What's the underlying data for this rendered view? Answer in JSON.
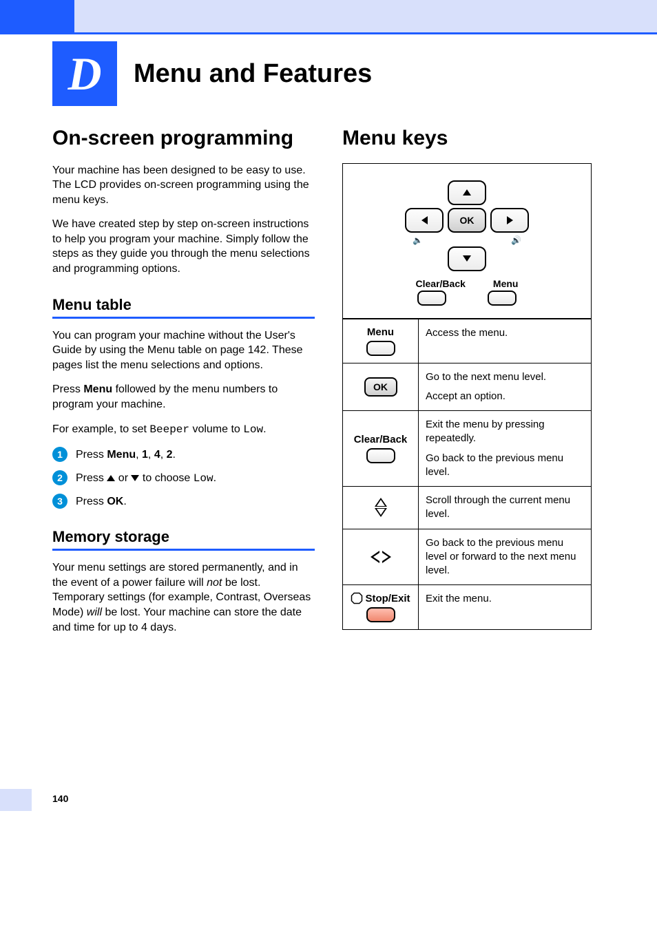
{
  "chapter": {
    "letter": "D",
    "title": "Menu and Features"
  },
  "left": {
    "h1": "On-screen programming",
    "p1": "Your machine has been designed to be easy to use. The LCD provides on-screen programming using the menu keys.",
    "p2": "We have created step by step on-screen instructions to help you program your machine. Simply follow the steps as they guide you through the menu selections and programming options.",
    "menu_table": {
      "heading": "Menu table",
      "p1": "You can program your machine without the User's Guide by using the Menu table on page 142. These pages list the menu selections and options.",
      "p2_a": "Press ",
      "p2_b": "Menu",
      "p2_c": " followed by the menu numbers to program your machine.",
      "p3_a": "For example, to set ",
      "p3_b": "Beeper",
      "p3_c": " volume to ",
      "p3_d": "Low",
      "p3_e": ".",
      "step1_a": "Press ",
      "step1_b": "Menu",
      "step1_c": ", ",
      "step1_d": "1",
      "step1_e": ", ",
      "step1_f": "4",
      "step1_g": ", ",
      "step1_h": "2",
      "step1_i": ".",
      "step2_a": "Press ",
      "step2_b": " or ",
      "step2_c": " to choose ",
      "step2_d": "Low",
      "step2_e": ".",
      "step3_a": "Press ",
      "step3_b": "OK",
      "step3_c": "."
    },
    "memory": {
      "heading": "Memory storage",
      "p_a": "Your menu settings are stored permanently, and in the event of a power failure will ",
      "p_not": "not",
      "p_b": " be lost. Temporary settings (for example, Contrast, Overseas Mode) ",
      "p_will": "will",
      "p_c": " be lost. Your machine can store the date and time for up to 4 days."
    }
  },
  "right": {
    "h1": "Menu keys",
    "keypad": {
      "ok": "OK",
      "clear_back": "Clear/Back",
      "menu": "Menu"
    },
    "table": {
      "menu_label": "Menu",
      "menu_desc": "Access the menu.",
      "ok_label": "OK",
      "ok_desc1": "Go to the next menu level.",
      "ok_desc2": "Accept an option.",
      "clear_label": "Clear/Back",
      "clear_desc1": "Exit the menu by pressing repeatedly.",
      "clear_desc2": "Go back to the previous menu level.",
      "updown_desc": "Scroll through the current menu level.",
      "leftright_desc": "Go back to the previous menu level or forward to the next menu level.",
      "stop_label": "Stop/Exit",
      "stop_desc": "Exit the menu."
    }
  },
  "page_number": "140"
}
